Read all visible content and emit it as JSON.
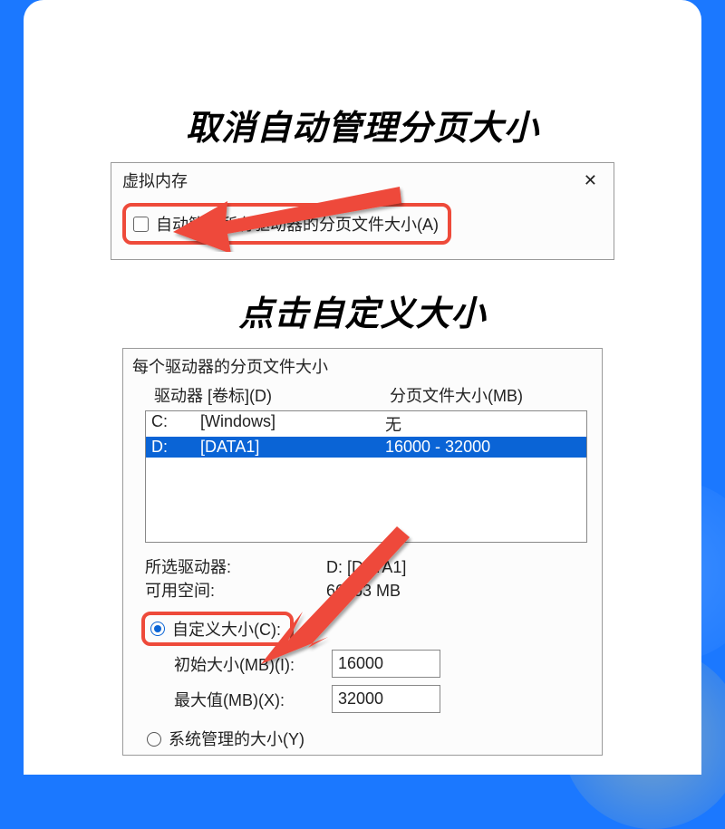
{
  "heading1": "取消自动管理分页大小",
  "heading2": "点击自定义大小",
  "panel1": {
    "title": "虚拟内存",
    "checkbox_label": "自动管理所有驱动器的分页文件大小(A)"
  },
  "panel2": {
    "group_title": "每个驱动器的分页文件大小",
    "header_drive": "驱动器 [卷标](D)",
    "header_size": "分页文件大小(MB)",
    "rows": [
      {
        "drive": "C:",
        "label": "[Windows]",
        "size": "无",
        "selected": false
      },
      {
        "drive": "D:",
        "label": "[DATA1]",
        "size": "16000 - 32000",
        "selected": true
      }
    ],
    "selected_drive_label": "所选驱动器:",
    "selected_drive_value": "D:  [DATA1]",
    "free_space_label": "可用空间:",
    "free_space_value": "66163 MB",
    "custom_size_label": "自定义大小(C):",
    "initial_label": "初始大小(MB)(I):",
    "initial_value": "16000",
    "max_label": "最大值(MB)(X):",
    "max_value": "32000",
    "system_managed_label": "系统管理的大小(Y)"
  },
  "colors": {
    "highlight": "#ee4a3a",
    "selection": "#0a64d6",
    "bg": "#1b78ff"
  }
}
